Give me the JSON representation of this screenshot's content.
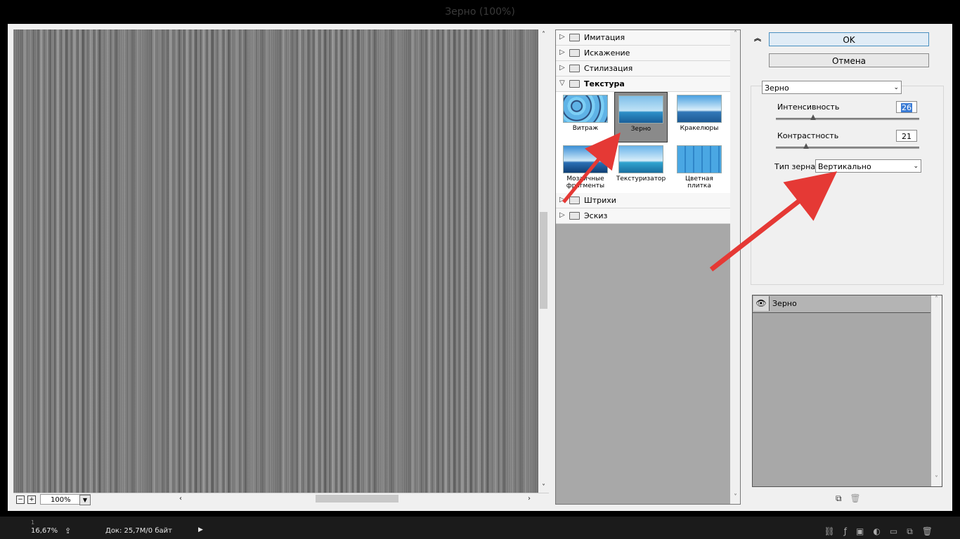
{
  "window": {
    "title": "Зерно (100%)"
  },
  "preview": {
    "zoom_value": "100%",
    "zoom_out_label": "−",
    "zoom_in_label": "+",
    "zoom_dropdown_icon": "chevron-down-icon"
  },
  "filter_gallery": {
    "categories": [
      {
        "label": "Имитация",
        "open": false
      },
      {
        "label": "Искажение",
        "open": false
      },
      {
        "label": "Стилизация",
        "open": false
      },
      {
        "label": "Текстура",
        "open": true
      },
      {
        "label": "Штрихи",
        "open": false
      },
      {
        "label": "Эскиз",
        "open": false
      }
    ],
    "texture_filters": [
      {
        "label": "Витраж"
      },
      {
        "label": "Зерно",
        "selected": true
      },
      {
        "label": "Кракелюры"
      },
      {
        "label": "Мозаичные фрагменты"
      },
      {
        "label": "Текстуризатор"
      },
      {
        "label": "Цветная плитка"
      }
    ]
  },
  "buttons": {
    "ok": "OK",
    "cancel": "Отмена"
  },
  "settings": {
    "filter_select": "Зерно",
    "intensity_label": "Интенсивность",
    "intensity_value": "26",
    "intensity_fraction": 0.26,
    "contrast_label": "Контрастность",
    "contrast_value": "21",
    "contrast_fraction": 0.21,
    "grain_type_label": "Тип зерна:",
    "grain_type_value": "Вертикально"
  },
  "effect_layers": [
    {
      "label": "Зерно",
      "visible": true
    }
  ],
  "statusbar": {
    "ruler_mark": "1",
    "zoom": "16,67%",
    "doc": "Док: 25,7M/0 байт"
  },
  "colors": {
    "annotation_arrow": "#e53935",
    "dialog_bg": "#f0f0f0",
    "selected_thumb": "#8a8a8a",
    "ok_border": "#4a90c0"
  }
}
